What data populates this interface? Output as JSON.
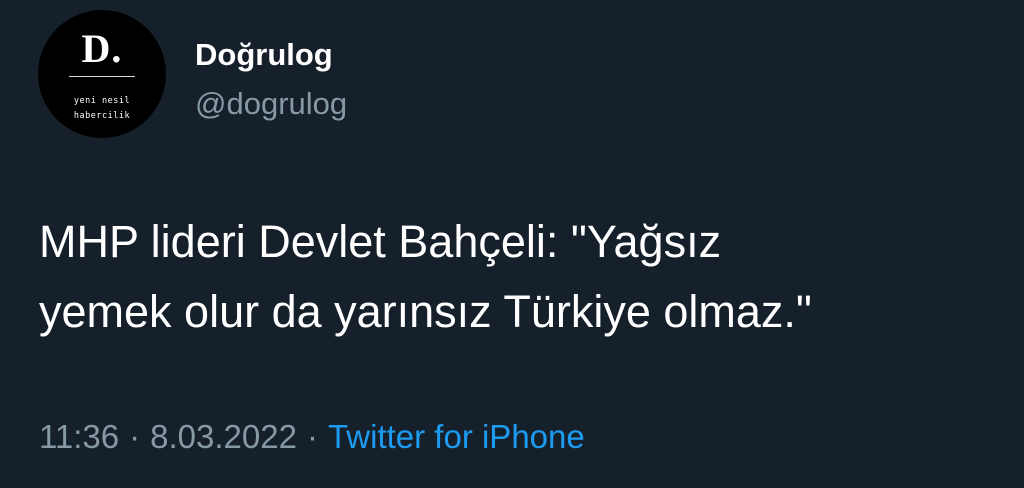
{
  "avatar": {
    "logo_letter": "D.",
    "tagline_line1": "yeni nesil",
    "tagline_line2": "habercilik"
  },
  "user": {
    "display_name": "Doğrulog",
    "handle": "@dogrulog"
  },
  "tweet": {
    "text_line1": "MHP lideri Devlet Bahçeli: \"Yağsız",
    "text_line2": "yemek olur da yarınsız Türkiye olmaz.\""
  },
  "meta": {
    "time": "11:36",
    "separator": "·",
    "date": "8.03.2022",
    "source": "Twitter for iPhone"
  },
  "colors": {
    "background": "#15202b",
    "primary_text": "#ffffff",
    "secondary_text": "#8899a6",
    "link": "#1d9bf0"
  }
}
